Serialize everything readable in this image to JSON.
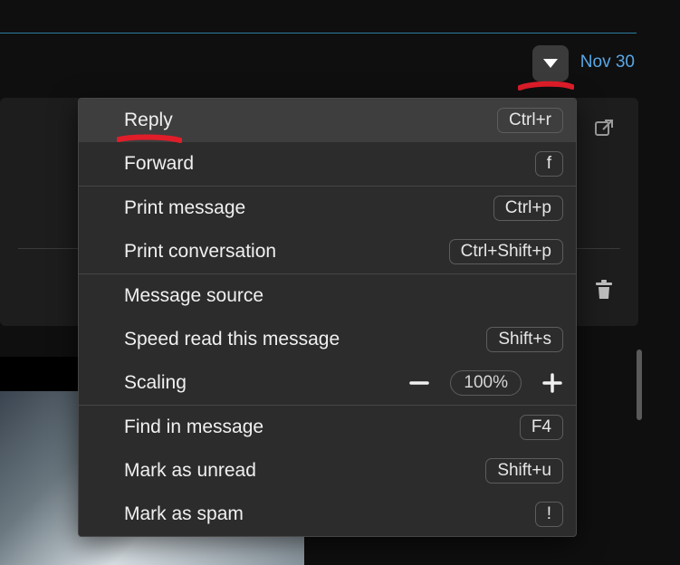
{
  "header": {
    "date": "Nov 30"
  },
  "menu": {
    "sections": [
      [
        {
          "label": "Reply",
          "shortcut": "Ctrl+r",
          "hover": true
        },
        {
          "label": "Forward",
          "shortcut": "f"
        }
      ],
      [
        {
          "label": "Print message",
          "shortcut": "Ctrl+p"
        },
        {
          "label": "Print conversation",
          "shortcut": "Ctrl+Shift+p"
        }
      ],
      [
        {
          "label": "Message source"
        },
        {
          "label": "Speed read this message",
          "shortcut": "Shift+s"
        },
        {
          "label": "Scaling",
          "scaling": {
            "value": "100%"
          }
        }
      ],
      [
        {
          "label": "Find in message",
          "shortcut": "F4"
        },
        {
          "label": "Mark as unread",
          "shortcut": "Shift+u"
        },
        {
          "label": "Mark as spam",
          "shortcut": "!"
        }
      ]
    ]
  },
  "annotations": {
    "trigger_underline_color": "#e11d2a",
    "reply_underline_color": "#e11d2a"
  }
}
